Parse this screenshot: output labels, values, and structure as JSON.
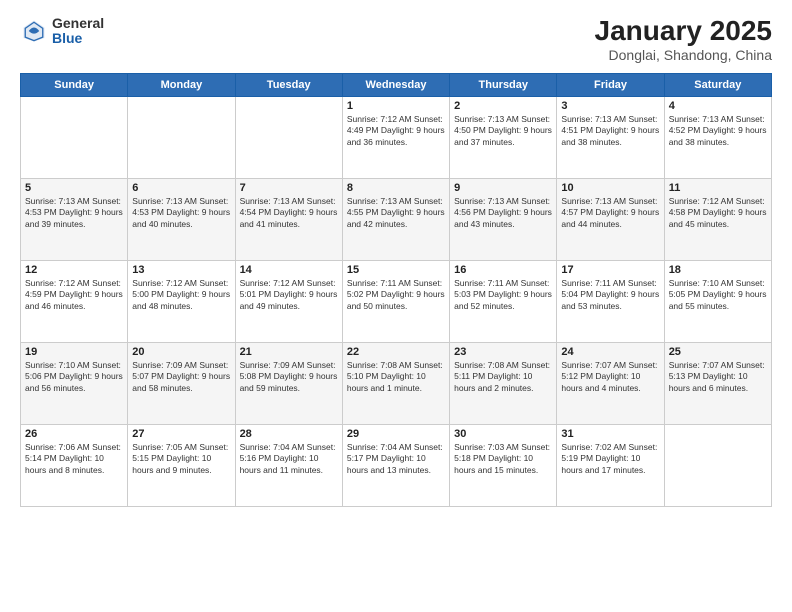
{
  "logo": {
    "general": "General",
    "blue": "Blue"
  },
  "title": "January 2025",
  "subtitle": "Donglai, Shandong, China",
  "days_header": [
    "Sunday",
    "Monday",
    "Tuesday",
    "Wednesday",
    "Thursday",
    "Friday",
    "Saturday"
  ],
  "weeks": [
    [
      {
        "day": "",
        "info": ""
      },
      {
        "day": "",
        "info": ""
      },
      {
        "day": "",
        "info": ""
      },
      {
        "day": "1",
        "info": "Sunrise: 7:12 AM\nSunset: 4:49 PM\nDaylight: 9 hours and 36 minutes."
      },
      {
        "day": "2",
        "info": "Sunrise: 7:13 AM\nSunset: 4:50 PM\nDaylight: 9 hours and 37 minutes."
      },
      {
        "day": "3",
        "info": "Sunrise: 7:13 AM\nSunset: 4:51 PM\nDaylight: 9 hours and 38 minutes."
      },
      {
        "day": "4",
        "info": "Sunrise: 7:13 AM\nSunset: 4:52 PM\nDaylight: 9 hours and 38 minutes."
      }
    ],
    [
      {
        "day": "5",
        "info": "Sunrise: 7:13 AM\nSunset: 4:53 PM\nDaylight: 9 hours and 39 minutes."
      },
      {
        "day": "6",
        "info": "Sunrise: 7:13 AM\nSunset: 4:53 PM\nDaylight: 9 hours and 40 minutes."
      },
      {
        "day": "7",
        "info": "Sunrise: 7:13 AM\nSunset: 4:54 PM\nDaylight: 9 hours and 41 minutes."
      },
      {
        "day": "8",
        "info": "Sunrise: 7:13 AM\nSunset: 4:55 PM\nDaylight: 9 hours and 42 minutes."
      },
      {
        "day": "9",
        "info": "Sunrise: 7:13 AM\nSunset: 4:56 PM\nDaylight: 9 hours and 43 minutes."
      },
      {
        "day": "10",
        "info": "Sunrise: 7:13 AM\nSunset: 4:57 PM\nDaylight: 9 hours and 44 minutes."
      },
      {
        "day": "11",
        "info": "Sunrise: 7:12 AM\nSunset: 4:58 PM\nDaylight: 9 hours and 45 minutes."
      }
    ],
    [
      {
        "day": "12",
        "info": "Sunrise: 7:12 AM\nSunset: 4:59 PM\nDaylight: 9 hours and 46 minutes."
      },
      {
        "day": "13",
        "info": "Sunrise: 7:12 AM\nSunset: 5:00 PM\nDaylight: 9 hours and 48 minutes."
      },
      {
        "day": "14",
        "info": "Sunrise: 7:12 AM\nSunset: 5:01 PM\nDaylight: 9 hours and 49 minutes."
      },
      {
        "day": "15",
        "info": "Sunrise: 7:11 AM\nSunset: 5:02 PM\nDaylight: 9 hours and 50 minutes."
      },
      {
        "day": "16",
        "info": "Sunrise: 7:11 AM\nSunset: 5:03 PM\nDaylight: 9 hours and 52 minutes."
      },
      {
        "day": "17",
        "info": "Sunrise: 7:11 AM\nSunset: 5:04 PM\nDaylight: 9 hours and 53 minutes."
      },
      {
        "day": "18",
        "info": "Sunrise: 7:10 AM\nSunset: 5:05 PM\nDaylight: 9 hours and 55 minutes."
      }
    ],
    [
      {
        "day": "19",
        "info": "Sunrise: 7:10 AM\nSunset: 5:06 PM\nDaylight: 9 hours and 56 minutes."
      },
      {
        "day": "20",
        "info": "Sunrise: 7:09 AM\nSunset: 5:07 PM\nDaylight: 9 hours and 58 minutes."
      },
      {
        "day": "21",
        "info": "Sunrise: 7:09 AM\nSunset: 5:08 PM\nDaylight: 9 hours and 59 minutes."
      },
      {
        "day": "22",
        "info": "Sunrise: 7:08 AM\nSunset: 5:10 PM\nDaylight: 10 hours and 1 minute."
      },
      {
        "day": "23",
        "info": "Sunrise: 7:08 AM\nSunset: 5:11 PM\nDaylight: 10 hours and 2 minutes."
      },
      {
        "day": "24",
        "info": "Sunrise: 7:07 AM\nSunset: 5:12 PM\nDaylight: 10 hours and 4 minutes."
      },
      {
        "day": "25",
        "info": "Sunrise: 7:07 AM\nSunset: 5:13 PM\nDaylight: 10 hours and 6 minutes."
      }
    ],
    [
      {
        "day": "26",
        "info": "Sunrise: 7:06 AM\nSunset: 5:14 PM\nDaylight: 10 hours and 8 minutes."
      },
      {
        "day": "27",
        "info": "Sunrise: 7:05 AM\nSunset: 5:15 PM\nDaylight: 10 hours and 9 minutes."
      },
      {
        "day": "28",
        "info": "Sunrise: 7:04 AM\nSunset: 5:16 PM\nDaylight: 10 hours and 11 minutes."
      },
      {
        "day": "29",
        "info": "Sunrise: 7:04 AM\nSunset: 5:17 PM\nDaylight: 10 hours and 13 minutes."
      },
      {
        "day": "30",
        "info": "Sunrise: 7:03 AM\nSunset: 5:18 PM\nDaylight: 10 hours and 15 minutes."
      },
      {
        "day": "31",
        "info": "Sunrise: 7:02 AM\nSunset: 5:19 PM\nDaylight: 10 hours and 17 minutes."
      },
      {
        "day": "",
        "info": ""
      }
    ]
  ]
}
